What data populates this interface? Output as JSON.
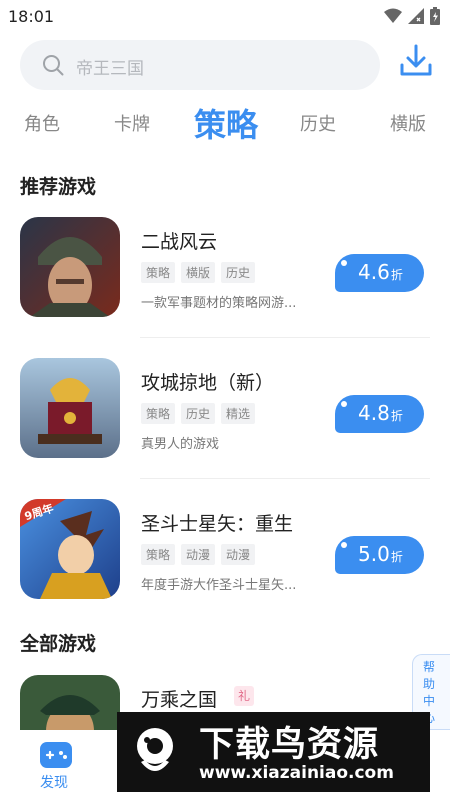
{
  "status_bar": {
    "time": "18:01"
  },
  "search": {
    "placeholder": "帝王三国"
  },
  "tabs": [
    {
      "label": "角色",
      "active": false
    },
    {
      "label": "卡牌",
      "active": false
    },
    {
      "label": "策略",
      "active": true
    },
    {
      "label": "历史",
      "active": false
    },
    {
      "label": "横版",
      "active": false
    }
  ],
  "sections": {
    "recommended": "推荐游戏",
    "all": "全部游戏"
  },
  "recommended_games": [
    {
      "name": "二战风云",
      "tags": [
        "策略",
        "横版",
        "历史"
      ],
      "desc": "一款军事题材的策略网游...",
      "discount": "4.6",
      "discount_unit": "折"
    },
    {
      "name": "攻城掠地（新）",
      "tags": [
        "策略",
        "历史",
        "精选"
      ],
      "desc": "真男人的游戏",
      "discount": "4.8",
      "discount_unit": "折"
    },
    {
      "name": "圣斗士星矢：重生",
      "tags": [
        "策略",
        "动漫",
        "动漫"
      ],
      "desc": "年度手游大作圣斗士星矢...",
      "discount": "5.0",
      "discount_unit": "折"
    }
  ],
  "all_games": [
    {
      "name": "万乘之国",
      "badge": "礼"
    }
  ],
  "icon_badges": {
    "anniversary": "9周年"
  },
  "help": {
    "label": "帮助中心"
  },
  "bottom_nav": {
    "discover": "发现"
  },
  "watermark": {
    "title": "下载鸟资源",
    "url": "www.xiazainiao.com"
  },
  "colors": {
    "accent": "#3b8ef0",
    "watermark_bg": "#111111"
  }
}
